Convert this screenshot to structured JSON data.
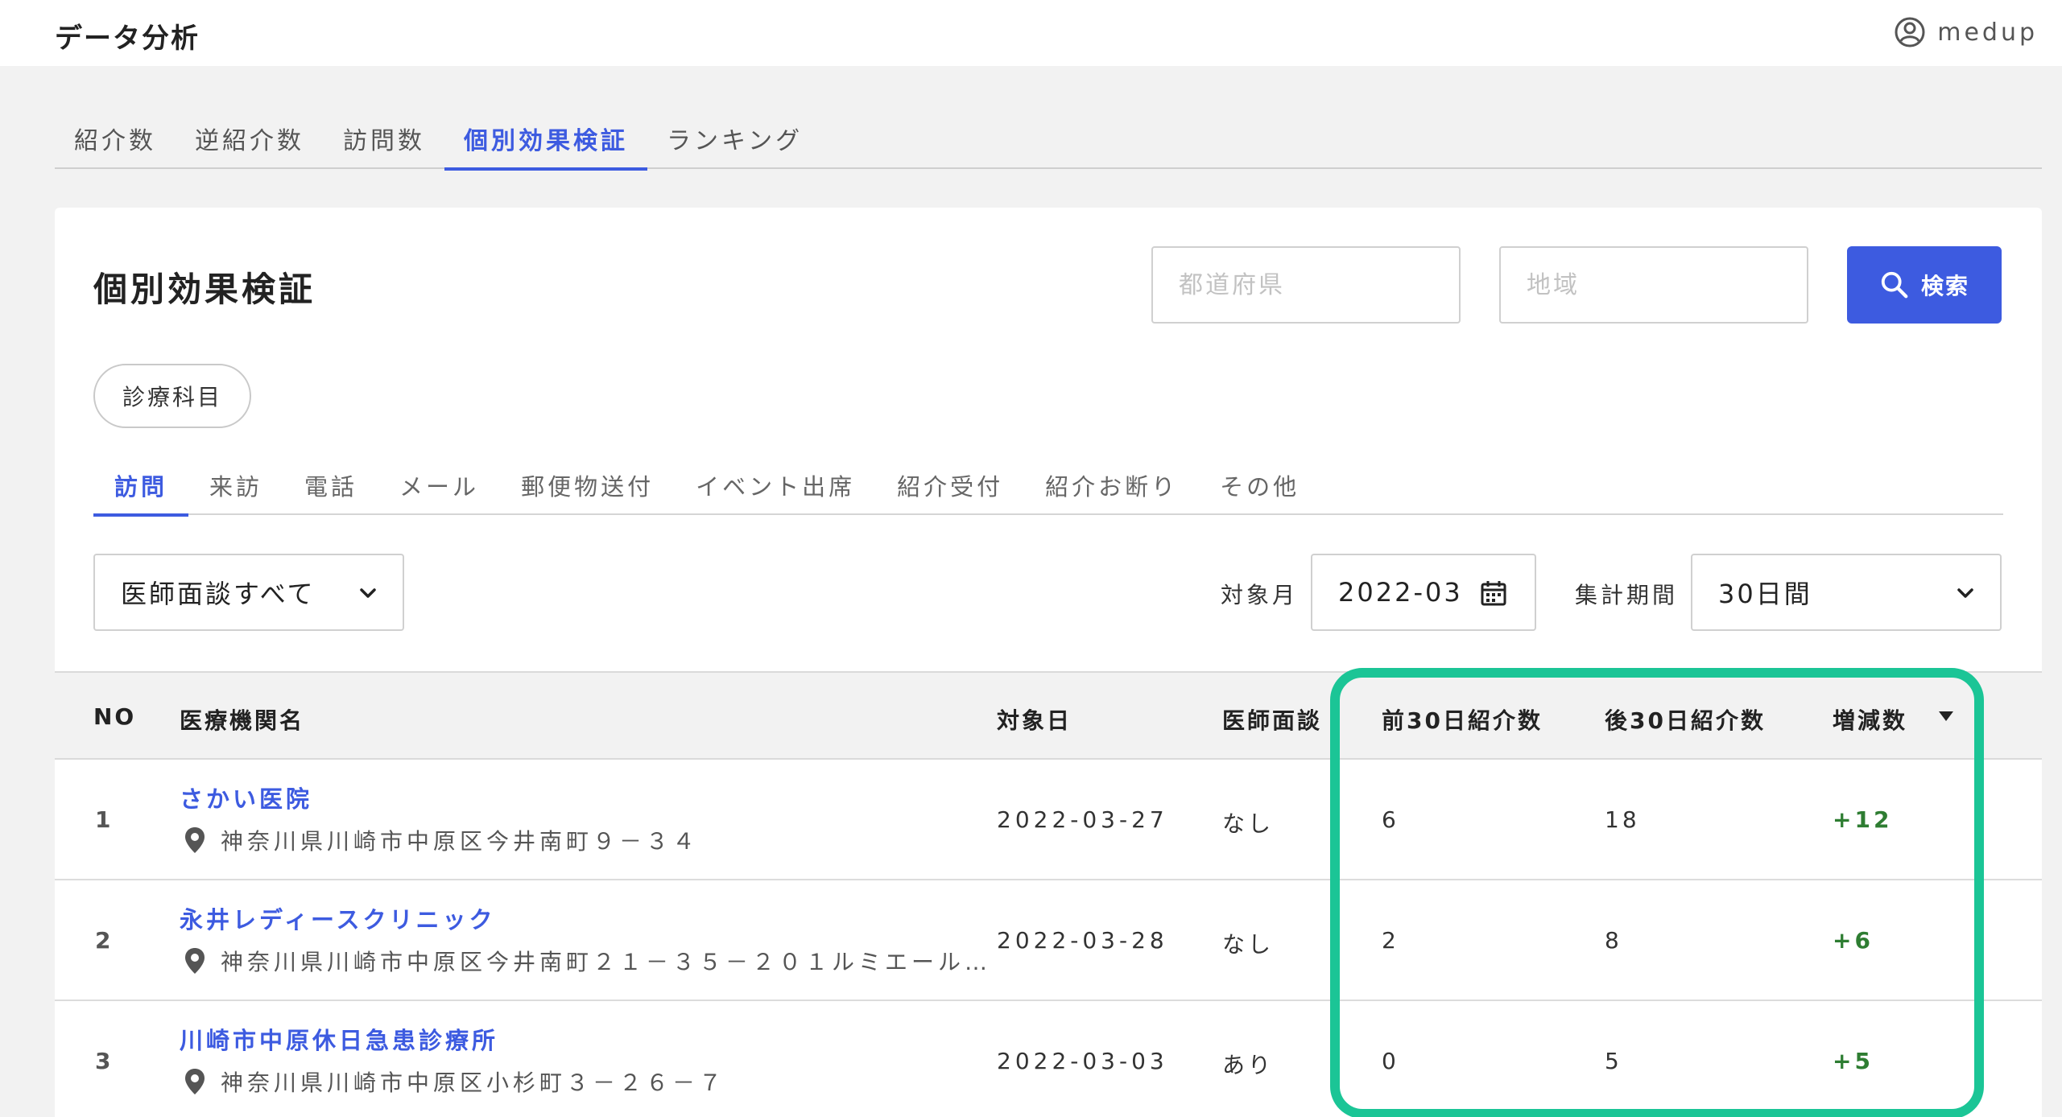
{
  "header": {
    "app_title": "データ分析",
    "user_name": "medup"
  },
  "main_tabs": [
    {
      "label": "紹介数"
    },
    {
      "label": "逆紹介数"
    },
    {
      "label": "訪問数"
    },
    {
      "label": "個別効果検証",
      "active": true
    },
    {
      "label": "ランキング"
    }
  ],
  "card": {
    "title": "個別効果検証",
    "prefecture_placeholder": "都道府県",
    "region_placeholder": "地域",
    "search_label": "検索",
    "department_chip": "診療科目"
  },
  "sub_tabs": [
    {
      "label": "訪問",
      "active": true
    },
    {
      "label": "来訪"
    },
    {
      "label": "電話"
    },
    {
      "label": "メール"
    },
    {
      "label": "郵便物送付"
    },
    {
      "label": "イベント出席"
    },
    {
      "label": "紹介受付"
    },
    {
      "label": "紹介お断り"
    },
    {
      "label": "その他"
    }
  ],
  "filters": {
    "interview_select": "医師面談すべて",
    "month_label": "対象月",
    "month_value": "2022-03",
    "period_label": "集計期間",
    "period_value": "30日間"
  },
  "table": {
    "headers": {
      "no": "NO",
      "name": "医療機関名",
      "date": "対象日",
      "doctor": "医師面談",
      "prev": "前30日紹介数",
      "next": "後30日紹介数",
      "diff": "増減数"
    },
    "rows": [
      {
        "no": "1",
        "name": "さかい医院",
        "address": "神奈川県川崎市中原区今井南町９－３４",
        "date": "2022-03-27",
        "doctor": "なし",
        "prev": "6",
        "next": "18",
        "diff": "+12"
      },
      {
        "no": "2",
        "name": "永井レディースクリニック",
        "address": "神奈川県川崎市中原区今井南町２１－３５－２０１ルミエール…",
        "date": "2022-03-28",
        "doctor": "なし",
        "prev": "2",
        "next": "8",
        "diff": "+6"
      },
      {
        "no": "3",
        "name": "川崎市中原休日急患診療所",
        "address": "神奈川県川崎市中原区小杉町３－２６－７",
        "date": "2022-03-03",
        "doctor": "あり",
        "prev": "0",
        "next": "5",
        "diff": "+5"
      }
    ]
  },
  "colors": {
    "accent": "#3d5be0",
    "positive": "#2e7d32",
    "highlight": "#1bc596"
  }
}
